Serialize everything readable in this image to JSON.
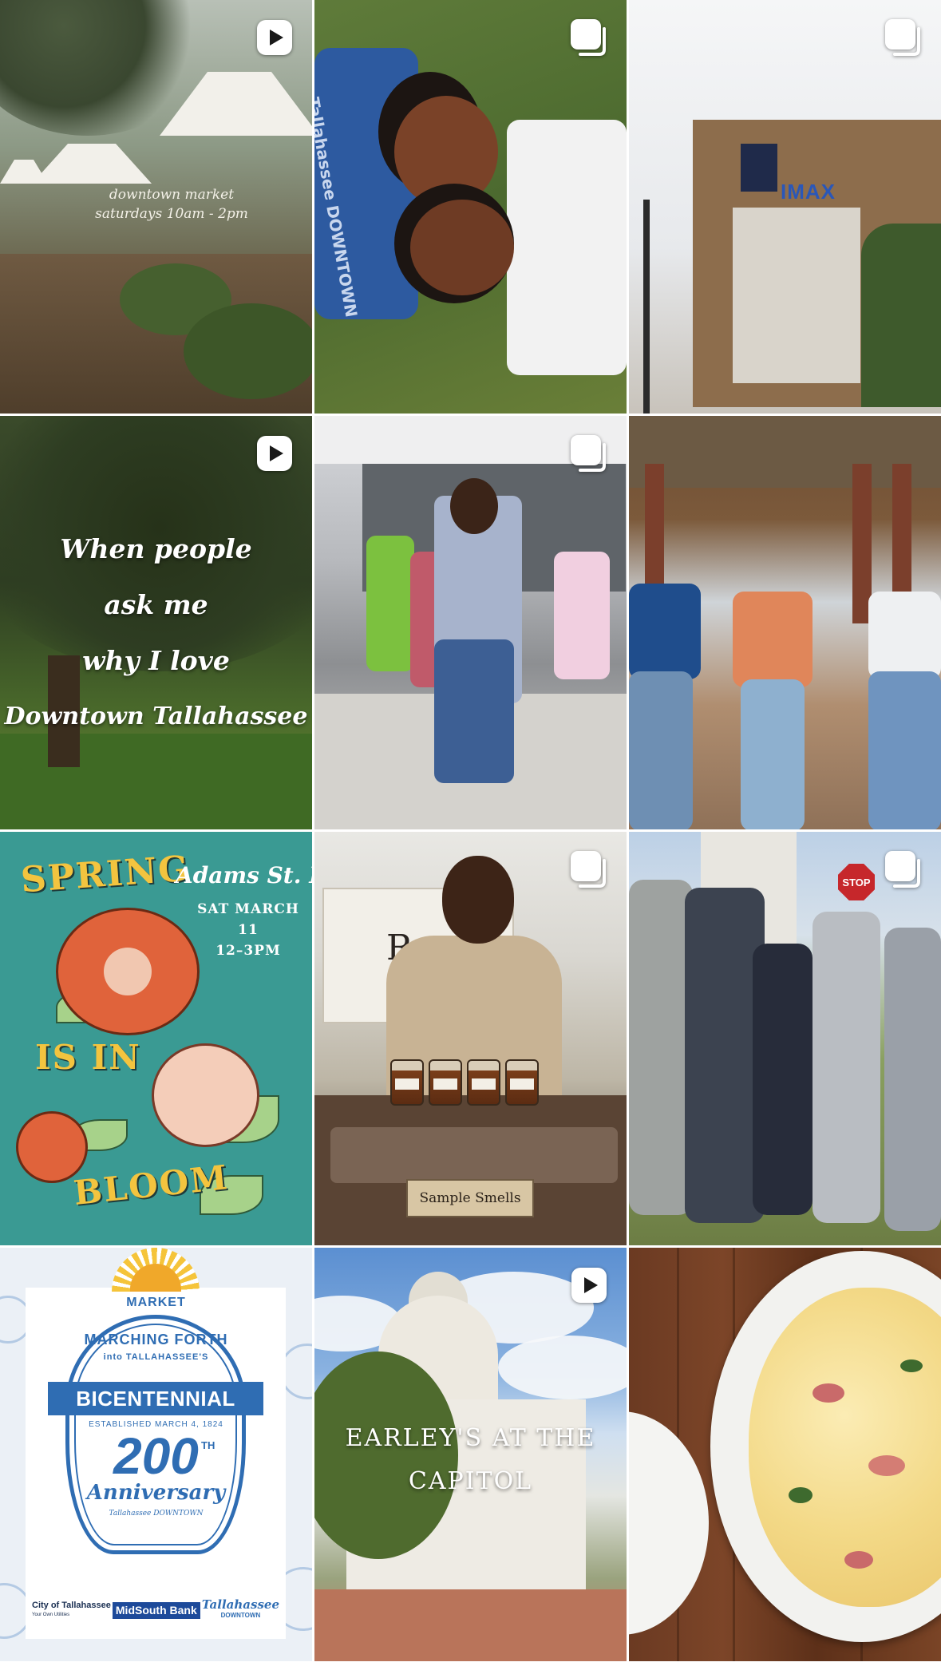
{
  "grid": {
    "tiles": [
      {
        "name": "post-downtown-market",
        "media_type": "reel",
        "badge_icon": "reels-icon",
        "caption_lines": [
          "downtown market",
          "saturdays 10am - 2pm"
        ]
      },
      {
        "name": "post-selfie-grass",
        "media_type": "carousel",
        "badge_icon": "carousel-icon",
        "shirt_text": "Tallahassee DOWNTOWN"
      },
      {
        "name": "post-challenger-imax",
        "media_type": "carousel",
        "badge_icon": "carousel-icon",
        "sign_text": "IMAX"
      },
      {
        "name": "post-why-i-love-downtown",
        "media_type": "reel",
        "badge_icon": "reels-icon",
        "quote_lines": [
          "When people",
          "ask me",
          "why I love",
          "Downtown Tallahassee"
        ]
      },
      {
        "name": "post-stage-performer",
        "media_type": "carousel",
        "badge_icon": "carousel-icon"
      },
      {
        "name": "post-walking-group",
        "media_type": "photo"
      },
      {
        "name": "post-spring-is-in-bloom",
        "media_type": "photo",
        "words": [
          "SPRING",
          "IS IN",
          "BLOOM"
        ],
        "event_name": "Adams St. Flea",
        "event_date_lines": [
          "SAT MARCH 11",
          "12–3PM"
        ]
      },
      {
        "name": "post-vendor-sample-smells",
        "media_type": "carousel",
        "badge_icon": "carousel-icon",
        "sign_text": "Sample Smells"
      },
      {
        "name": "post-group-photo",
        "media_type": "carousel",
        "badge_icon": "carousel-icon",
        "stop_sign": "STOP"
      },
      {
        "name": "post-bicentennial-market",
        "media_type": "photo",
        "logo": {
          "market": "MARKET",
          "arc_line_1": "MARCHING FORTH",
          "arc_line_2": "into TALLAHASSEE'S",
          "ribbon": "BICENTENNIAL",
          "established": "ESTABLISHED MARCH 4, 1824",
          "number": "200",
          "suffix": "TH",
          "anniversary": "Anniversary",
          "anniv_sub": "Tallahassee DOWNTOWN"
        },
        "sponsors": {
          "city": "City of Tallahassee",
          "city_tagline": "Your Own Utilities",
          "bank": "MidSouth Bank",
          "downtown": "Tallahassee",
          "downtown_sub": "DOWNTOWN"
        }
      },
      {
        "name": "post-earleys-at-the-capitol",
        "media_type": "reel",
        "badge_icon": "reels-icon",
        "title_lines": [
          "EARLEY'S AT THE",
          "CAPITOL"
        ]
      },
      {
        "name": "post-pasta-dish",
        "media_type": "photo"
      }
    ]
  },
  "colors": {
    "poster_teal": "#3a9a93",
    "poster_yellow": "#f3c43f",
    "logo_blue": "#2f6db3",
    "badge_white": "#ffffff"
  }
}
